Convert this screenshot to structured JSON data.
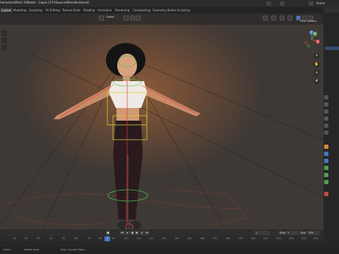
{
  "title": "haracters\\Pack 2\\Model - Copie (37)\\Source\\Blender.blend]",
  "workspace_tabs": [
    "Layout",
    "Modeling",
    "Sculpting",
    "UV Editing",
    "Texture Paint",
    "Shading",
    "Animation",
    "Rendering",
    "Compositing",
    "Geometry Nodes",
    "Scripting"
  ],
  "active_tab": "Layout",
  "scene_label": "Scene",
  "viewport": {
    "mode_label": "Global",
    "pose_options": "Pose Options",
    "gizmo": {
      "x": "X",
      "y": "Y",
      "z": "Z"
    }
  },
  "icons": {
    "search": "search-icon",
    "zoom": "zoom-icon",
    "hand": "hand-icon",
    "camera": "camera-icon",
    "grid": "grid-icon"
  },
  "timeline": {
    "current_frame": "1",
    "start_label": "Start",
    "start_value": "1",
    "end_label": "End",
    "end_value": "250",
    "ticks": [
      "10",
      "20",
      "30",
      "40",
      "50",
      "60",
      "70",
      "80",
      "90",
      "100",
      "110",
      "120",
      "130",
      "140",
      "150",
      "160",
      "170",
      "180",
      "190",
      "200",
      "210",
      "220",
      "230",
      "240",
      "250"
    ]
  },
  "status": {
    "left": "Select",
    "middle": "Rotate View",
    "right": "Pose Context Menu"
  },
  "colors": {
    "accent": "#4876c6",
    "bone_yellow": "#d8d030",
    "bone_green": "#4ec04e",
    "bone_red": "#e03a3a"
  }
}
